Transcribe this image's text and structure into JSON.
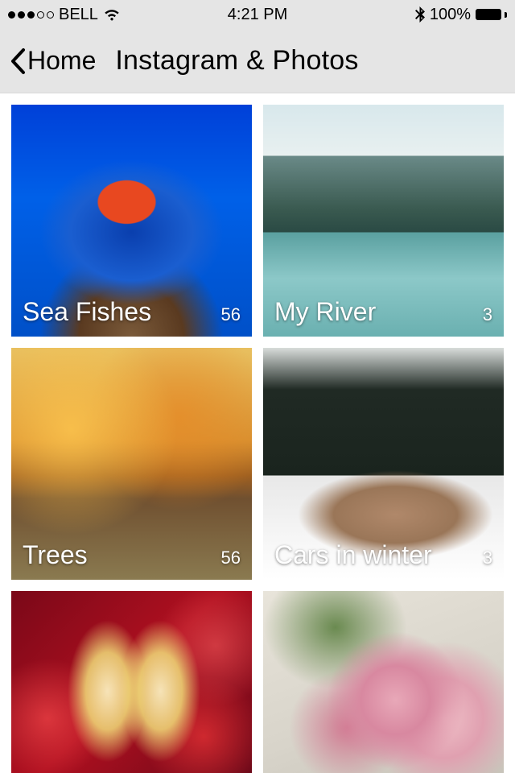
{
  "status": {
    "carrier": "BELL",
    "time": "4:21 PM",
    "battery_pct": "100%"
  },
  "nav": {
    "back_label": "Home",
    "title": "Instagram & Photos"
  },
  "albums": [
    {
      "title": "Sea Fishes",
      "count": "56",
      "img_class": "img-fish",
      "show_label": true
    },
    {
      "title": "My River",
      "count": "3",
      "img_class": "img-river",
      "show_label": true
    },
    {
      "title": "Trees",
      "count": "56",
      "img_class": "img-trees",
      "show_label": true
    },
    {
      "title": "Cars in winter",
      "count": "3",
      "img_class": "img-car",
      "show_label": true
    },
    {
      "title": "",
      "count": "",
      "img_class": "img-wine",
      "show_label": false
    },
    {
      "title": "",
      "count": "",
      "img_class": "img-flowers",
      "show_label": false
    }
  ]
}
